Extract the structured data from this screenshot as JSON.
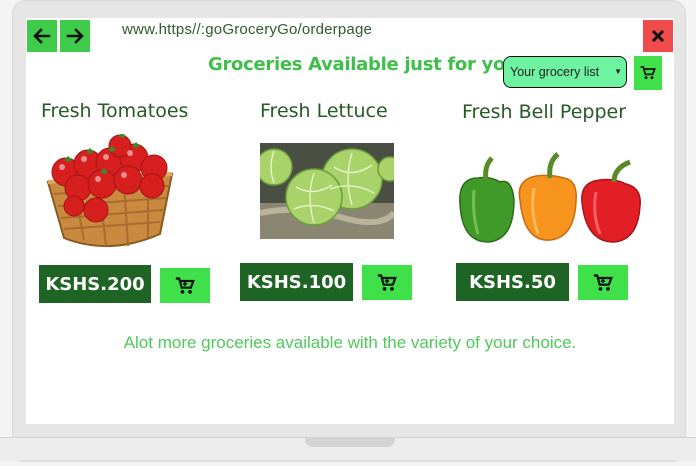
{
  "browser": {
    "url": "www.https//:goGroceryGo/orderpage",
    "back_icon": "arrow-left-icon",
    "forward_icon": "arrow-right-icon",
    "close_icon": "close-icon"
  },
  "header": {
    "headline": "Groceries Available just for you!",
    "grocery_select_value": "Your grocery list",
    "cart_icon": "cart-icon"
  },
  "products": [
    {
      "name": "Fresh Tomatoes",
      "price": "KSHS.200",
      "image": "tomatoes-basket"
    },
    {
      "name": "Fresh Lettuce",
      "price": "KSHS.100",
      "image": "lettuce"
    },
    {
      "name": "Fresh Bell Pepper",
      "price": "KSHS.50",
      "image": "bell-peppers"
    }
  ],
  "footer": {
    "text": "Alot more groceries available with the variety of your choice."
  },
  "colors": {
    "accent_green": "#3fe04a",
    "dark_green": "#1e6424",
    "close_red": "#ef4b4b",
    "select_mint": "#6ef3a0"
  }
}
